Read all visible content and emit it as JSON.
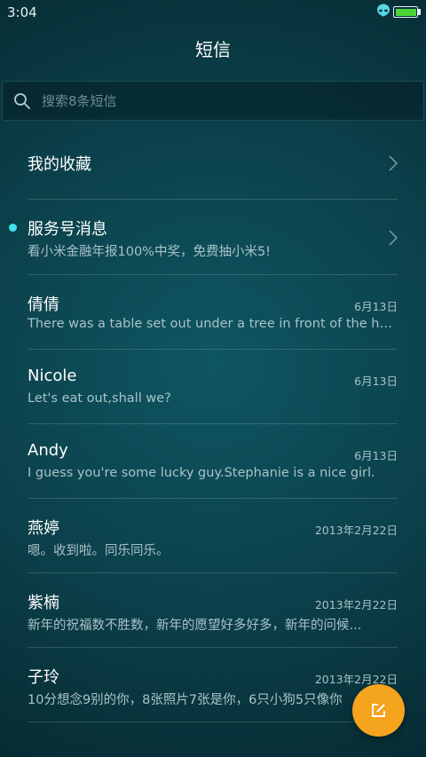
{
  "status_bar": {
    "time": "3:04",
    "battery_color": "#4cd33a"
  },
  "header": {
    "title": "短信"
  },
  "search": {
    "placeholder": "搜索8条短信"
  },
  "favorites": {
    "label": "我的收藏"
  },
  "service": {
    "name": "服务号消息",
    "preview": "看小米金融年报100%中奖，免费抽小米5!",
    "unread": true,
    "dot_color": "#41e1ef"
  },
  "messages": [
    {
      "name": "倩倩",
      "preview": "There was a table set out under a tree in front of the ho...",
      "date": "6月13日"
    },
    {
      "name": "Nicole",
      "preview": "Let's eat out,shall we?",
      "date": "6月13日"
    },
    {
      "name": "Andy",
      "preview": "I guess you're some lucky guy.Stephanie is a nice girl.",
      "date": "6月13日"
    },
    {
      "name": "燕婷",
      "preview": "嗯。收到啦。同乐同乐。",
      "date": "2013年2月22日"
    },
    {
      "name": "紫楠",
      "preview": "新年的祝福数不胜数，新年的愿望好多好多，新年的问候...",
      "date": "2013年2月22日"
    },
    {
      "name": "子玲",
      "preview": "10分想念9别的你，8张照片7张是你，6只小狗5只像你",
      "date": "2013年2月22日"
    }
  ],
  "compose": {
    "icon": "compose-icon",
    "color": "#f5a41e"
  }
}
